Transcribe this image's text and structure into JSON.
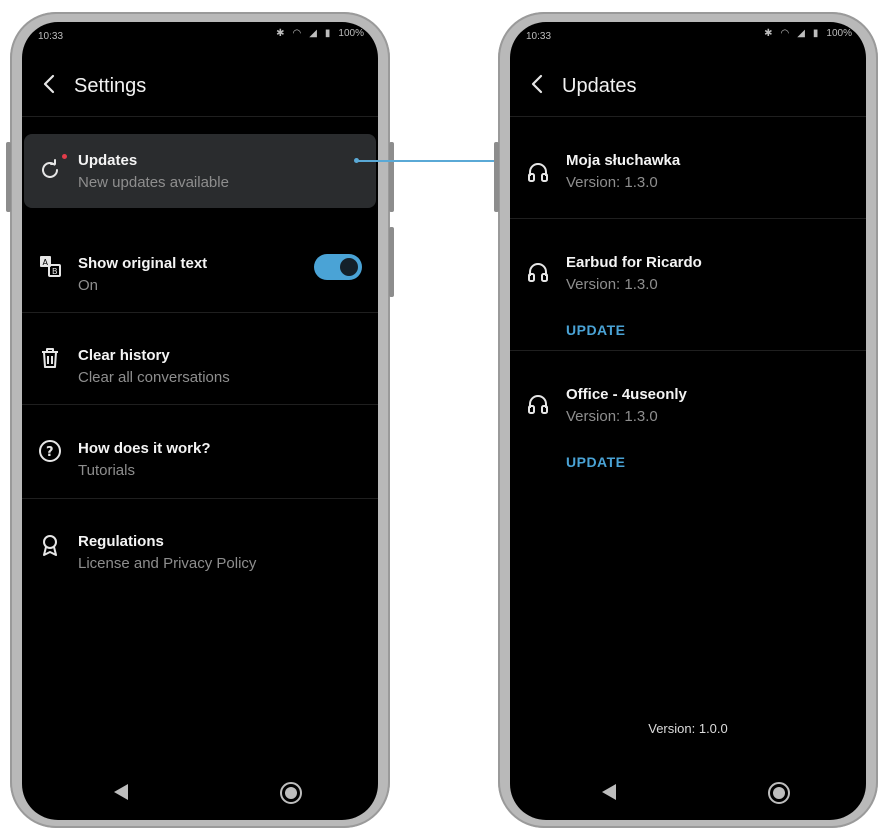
{
  "status_bar": {
    "time": "10:33",
    "battery": "100%"
  },
  "settings": {
    "title": "Settings",
    "items": [
      {
        "title": "Updates",
        "subtitle": "New updates available",
        "icon": "refresh-icon",
        "badge": true
      },
      {
        "title": "Show original text",
        "subtitle": "On",
        "icon": "translate-icon",
        "toggle_on": true
      },
      {
        "title": "Clear history",
        "subtitle": "Clear all conversations",
        "icon": "trash-icon"
      },
      {
        "title": "How does it work?",
        "subtitle": "Tutorials",
        "icon": "question-icon"
      },
      {
        "title": "Regulations",
        "subtitle": "License and Privacy Policy",
        "icon": "award-icon"
      }
    ]
  },
  "updates": {
    "title": "Updates",
    "devices": [
      {
        "name": "Moja słuchawka",
        "version": "Version: 1.3.0",
        "icon": "headphones-icon"
      },
      {
        "name": "Earbud for Ricardo",
        "version": "Version: 1.3.0",
        "action": "UPDATE",
        "icon": "headphones-icon"
      },
      {
        "name": "Office - 4useonly",
        "version": "Version: 1.3.0",
        "action": "UPDATE",
        "icon": "headphones-icon"
      }
    ],
    "app_version": "Version: 1.0.0"
  },
  "colors": {
    "accent": "#4aa3d6",
    "background": "#000000",
    "badge": "#e23c4a"
  }
}
